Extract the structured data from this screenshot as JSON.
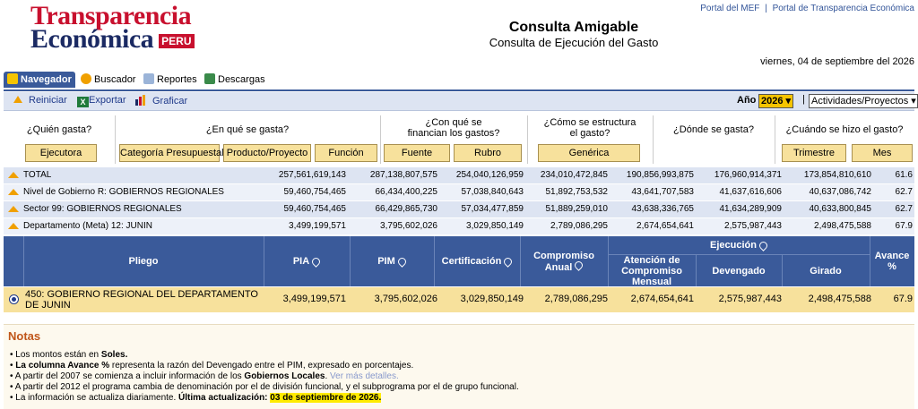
{
  "header": {
    "logo_line1": "Transparencia",
    "logo_line2": "Económica",
    "logo_tag": "PERU",
    "title": "Consulta Amigable",
    "subtitle": "Consulta de Ejecución del Gasto",
    "link_mef": "Portal del MEF",
    "link_sep": "|",
    "link_te": "Portal de Transparencia Económica",
    "date": "viernes, 04 de septiembre del 2026"
  },
  "tabs": [
    {
      "label": "Navegador"
    },
    {
      "label": "Buscador"
    },
    {
      "label": "Reportes"
    },
    {
      "label": "Descargas"
    }
  ],
  "toolbar": {
    "reiniciar": "Reiniciar",
    "exportar": "Exportar",
    "graficar": "Graficar",
    "year_label": "Año",
    "year_value": "2026",
    "view_value": "Actividades/Proyectos"
  },
  "questions": [
    {
      "text": "¿Quién gasta?",
      "buttons": [
        "Ejecutora"
      ]
    },
    {
      "text": "¿En qué se gasta?",
      "buttons": [
        "Categoría Presupuestal",
        "Producto/Proyecto",
        "Función"
      ]
    },
    {
      "text": "¿Con qué se financian los gastos?",
      "buttons": [
        "Fuente",
        "Rubro"
      ]
    },
    {
      "text": "¿Cómo se estructura el gasto?",
      "buttons": [
        "Genérica"
      ]
    },
    {
      "text": "¿Dónde se gasta?",
      "buttons": []
    },
    {
      "text": "¿Cuándo se hizo el gasto?",
      "buttons": [
        "Trimestre",
        "Mes"
      ]
    }
  ],
  "totals": [
    {
      "label": "TOTAL",
      "values": [
        "257,561,619,143",
        "287,138,807,575",
        "254,040,126,959",
        "234,010,472,845",
        "190,856,993,875",
        "176,960,914,371",
        "173,854,810,610",
        "61.6"
      ]
    },
    {
      "label": "Nivel de Gobierno R: GOBIERNOS REGIONALES",
      "values": [
        "59,460,754,465",
        "66,434,400,225",
        "57,038,840,643",
        "51,892,753,532",
        "43,641,707,583",
        "41,637,616,606",
        "40,637,086,742",
        "62.7"
      ]
    },
    {
      "label": "Sector 99: GOBIERNOS REGIONALES",
      "values": [
        "59,460,754,465",
        "66,429,865,730",
        "57,034,477,859",
        "51,889,259,010",
        "43,638,336,765",
        "41,634,289,909",
        "40,633,800,845",
        "62.7"
      ]
    },
    {
      "label": "Departamento (Meta) 12: JUNIN",
      "values": [
        "3,499,199,571",
        "3,795,602,026",
        "3,029,850,149",
        "2,789,086,295",
        "2,674,654,641",
        "2,575,987,443",
        "2,498,475,588",
        "67.9"
      ]
    }
  ],
  "table_headers": {
    "pliego": "Pliego",
    "pia": "PIA",
    "pim": "PIM",
    "certificacion": "Certificación",
    "compromiso": "Compromiso Anual",
    "ejecucion": "Ejecución",
    "atencion": "Atención de Compromiso Mensual",
    "devengado": "Devengado",
    "girado": "Girado",
    "avance": "Avance %"
  },
  "selected_row": {
    "pliego": "450: GOBIERNO REGIONAL DEL DEPARTAMENTO DE JUNIN",
    "values": [
      "3,499,199,571",
      "3,795,602,026",
      "3,029,850,149",
      "2,789,086,295",
      "2,674,654,641",
      "2,575,987,443",
      "2,498,475,588",
      "67.9"
    ]
  },
  "notes": {
    "title": "Notas",
    "n1a": "• Los montos están en ",
    "n1b": "Soles.",
    "n2a": "• ",
    "n2b": "La columna Avance %",
    "n2c": " representa la razón del Devengado entre el PIM, expresado en porcentajes.",
    "n3a": "• A partir del 2007 se comienza a incluir información de los ",
    "n3b": "Gobiernos Locales",
    "n3c": ". ",
    "n3d": "Ver más detalles.",
    "n4": "• A partir del 2012 el programa cambia de denominación por el de división funcional, y el subprograma por el de grupo funcional.",
    "n5a": "• La información se actualiza diariamente. ",
    "n5b": "Última actualización:",
    "n5c": "03 de septiembre de 2026."
  }
}
